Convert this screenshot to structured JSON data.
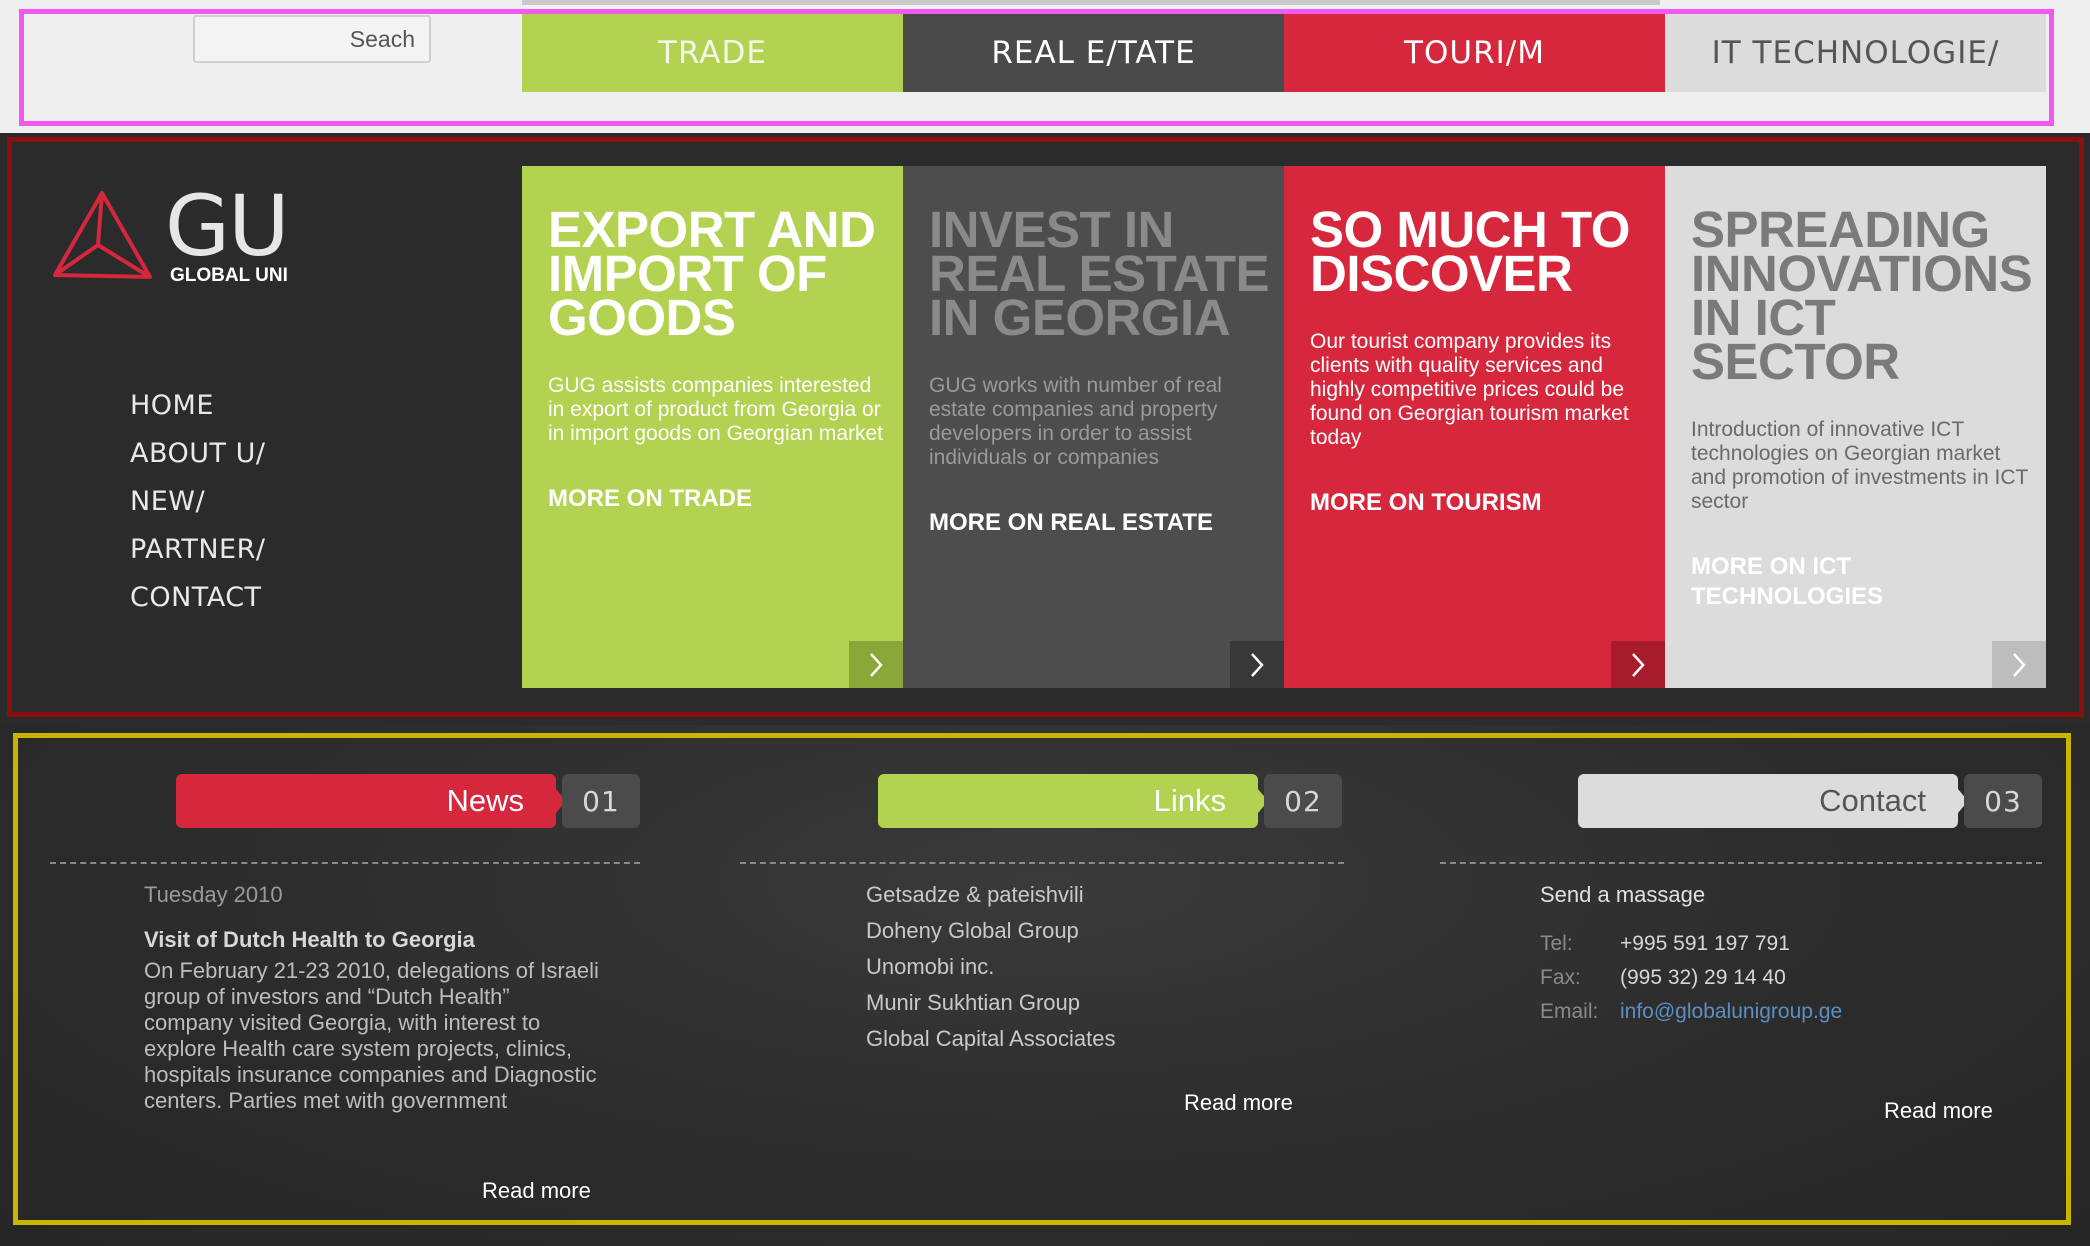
{
  "search": {
    "placeholder": "Seach"
  },
  "top_nav": [
    {
      "label": "TRADE",
      "bg": "#b3d251",
      "color": "#f4f7e6"
    },
    {
      "label": "REAL E/TATE",
      "bg": "#4a4a4a",
      "color": "#ffffff"
    },
    {
      "label": "TOURI/M",
      "bg": "#d6273c",
      "color": "#ffffff"
    },
    {
      "label": "IT TECHNOLOGIE/",
      "bg": "#dcdcdc",
      "color": "#555555"
    }
  ],
  "logo": {
    "title": "GU",
    "subtitle": "GLOBAL UNI",
    "mark_color": "#d6273c"
  },
  "main_nav": [
    "HOME",
    "ABOUT U/",
    "NEW/",
    "PARTNER/",
    "CONTACT"
  ],
  "panels": [
    {
      "title": "EXPORT AND IMPORT OF GOODS",
      "desc": "GUG assists companies interested in export of product from Georgia or in import goods on Georgian market",
      "link": "MORE ON TRADE",
      "bg": "#b3d251",
      "title_color": "#ffffff",
      "desc_color": "#ffffff",
      "link_color": "#ffffff",
      "arrow_bg": "#8aa83a"
    },
    {
      "title": "INVEST IN REAL ESTATE IN GEORGIA",
      "desc": "GUG works with number of real estate companies and property developers in order to assist individuals or companies",
      "link": "MORE ON REAL ESTATE",
      "bg": "#4d4d4d",
      "title_color": "#8a8a8a",
      "desc_color": "#9a9a9a",
      "link_color": "#ffffff",
      "arrow_bg": "#383838"
    },
    {
      "title": "SO MUCH TO DISCOVER",
      "desc": "Our tourist company provides its clients with quality services and highly competitive prices could be found on Georgian tourism market today",
      "link": "MORE ON TOURISM",
      "bg": "#d6273c",
      "title_color": "#ffffff",
      "desc_color": "#ffffff",
      "link_color": "#ffffff",
      "arrow_bg": "#a81b2b"
    },
    {
      "title": "SPREADING INNOVATIONS IN ICT SECTOR",
      "desc": "Introduction of innovative ICT technologies on Georgian market and promotion of investments in ICT sector",
      "link": "MORE ON ICT TECHNOLOGIES",
      "bg": "#dcdcdc",
      "title_color": "#7a7a7a",
      "desc_color": "#6a6a6a",
      "link_color": "#ffffff",
      "arrow_bg": "#bdbdbd"
    }
  ],
  "sections": {
    "news": {
      "label": "News",
      "num": "01",
      "color": "#d6273c"
    },
    "links": {
      "label": "Links",
      "num": "02",
      "color": "#b3d251"
    },
    "contact": {
      "label": "Contact",
      "num": "03",
      "color": "#dcdcdc"
    }
  },
  "news": {
    "date": "Tuesday 2010",
    "headline": "Visit of Dutch Health to Georgia",
    "body": "On February 21-23 2010, delegations of Israeli group of investors and “Dutch Health” company visited Georgia, with interest to explore Health care system projects, clinics, hospitals insurance companies and Diagnostic centers. Parties met with government",
    "read_more": "Read more"
  },
  "links": {
    "items": [
      "Getsadze & pateishvili",
      "Doheny Global Group",
      "Unomobi inc.",
      "Munir Sukhtian Group",
      "Global Capital Associates"
    ],
    "read_more": "Read more"
  },
  "contact": {
    "heading": "Send a massage",
    "tel_label": "Tel:",
    "tel": "+995 591 197 791",
    "fax_label": "Fax:",
    "fax": "(995 32) 29 14 40",
    "email_label": "Email:",
    "email": "info@globalunigroup.ge",
    "read_more": "Read more"
  }
}
